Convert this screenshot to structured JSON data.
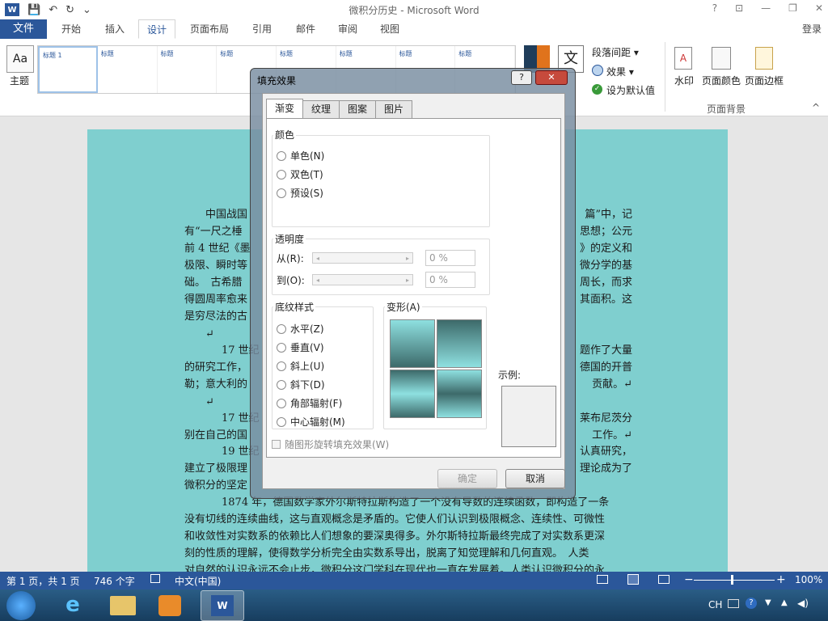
{
  "window": {
    "title": "微积分历史 - Microsoft Word",
    "help": "?",
    "ribbon_toggle": "⊡",
    "minimize": "—",
    "restore": "❐",
    "close": "✕"
  },
  "qat": {
    "logo": "W",
    "save": "💾",
    "undo": "↶",
    "redo": "↻",
    "customize": "⌄"
  },
  "menu": {
    "file": "文件",
    "tabs": [
      "开始",
      "插入",
      "设计",
      "页面布局",
      "引用",
      "邮件",
      "审阅",
      "视图"
    ],
    "active_tab": "设计",
    "login": "登录"
  },
  "ribbon": {
    "theme": "主题",
    "gallery_items": [
      "标题 1",
      "标题",
      "标题",
      "标题",
      "标题",
      "标题",
      "标题",
      "标题"
    ],
    "paragraph_spacing": "段落间距 ▾",
    "effects": "效果 ▾",
    "set_default": "设为默认值",
    "watermark": "水印",
    "page_color": "页面颜色",
    "page_border": "页面边框",
    "page_background_group": "页面背景",
    "collapse": "^"
  },
  "document": {
    "paragraphs": [
      "中国战国",
      "有“一尺之棰",
      "前 4 世纪《墨",
      "极限、瞬时等",
      "础。　古希腊",
      "得圆周率愈来",
      "是穷尽法的古"
    ],
    "right_fragments": [
      "篇”中，记",
      "思想；公元",
      "》的定义和",
      "微分学的基",
      "周长，而求",
      "其面积。这"
    ],
    "p17a_left": [
      "17 世纪",
      "的研究工作，",
      "勒；意大利的"
    ],
    "p17a_right": [
      "题作了大量",
      "德国的开普",
      "贡献。↵"
    ],
    "p17b_left": [
      "17 世纪",
      "别在自己的国"
    ],
    "p17b_right": [
      "莱布尼茨分",
      "工作。↵"
    ],
    "p19_left": [
      "19 世纪",
      "建立了极限理",
      "微积分的坚定"
    ],
    "p19_right": [
      "认真研究，",
      "理论成为了"
    ],
    "p1874": [
      "1874 年，德国数学家外尔斯特拉斯构造了一个没有导数的连续函数，即构造了一条",
      "没有切线的连续曲线，这与直观概念是矛盾的。它使人们认识到极限概念、连续性、可微性",
      "和收敛性对实数系的依赖比人们想象的要深奥得多。外尔斯特拉斯最终完成了对实数系更深",
      "刻的性质的理解，使得数学分析完全由实数系导出，脱离了知觉理解和几何直观。　人类",
      "对自然的认识永远不会止步，微积分这门学科在现代也一直在发展着。人类认识微积分的永"
    ],
    "para_mark": "↵"
  },
  "dialog": {
    "title": "填充效果",
    "help": "?",
    "close": "✕",
    "tabs": [
      "渐变",
      "纹理",
      "图案",
      "图片"
    ],
    "active_tab": "渐变",
    "color_group": "颜色",
    "color_options": [
      "单色(N)",
      "双色(T)",
      "预设(S)"
    ],
    "transparency_group": "透明度",
    "from_label": "从(R):",
    "to_label": "到(O):",
    "from_value": "0 %",
    "to_value": "0 %",
    "shading_group": "底纹样式",
    "shading_options": [
      "水平(Z)",
      "垂直(V)",
      "斜上(U)",
      "斜下(D)",
      "角部辐射(F)",
      "中心辐射(M)"
    ],
    "variants_label": "变形(A)",
    "sample_label": "示例:",
    "rotate_checkbox": "随图形旋转填充效果(W)",
    "ok": "确定",
    "cancel": "取消"
  },
  "status": {
    "page": "第 1 页，共 1 页",
    "words": "746 个字",
    "lang": "中文(中国)",
    "zoom": "100%"
  },
  "taskbar": {
    "tray_lang": "CH"
  },
  "colors": {
    "word_blue": "#2b579a",
    "page_teal": "#7fcfcf",
    "grad_dark": "#3d6a6a",
    "grad_light": "#8ee0e0"
  }
}
